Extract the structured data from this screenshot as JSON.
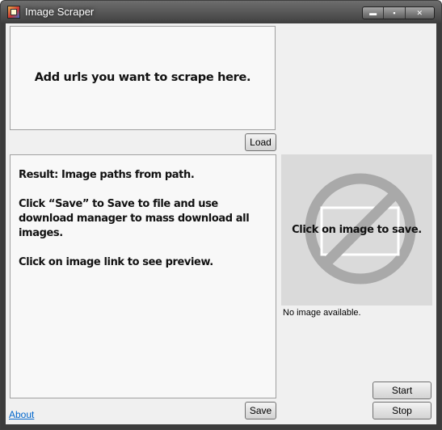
{
  "window": {
    "title": "Image Scraper",
    "controls": {
      "minimize": "▬",
      "maximize": "▪",
      "close": "✕"
    }
  },
  "url_input": {
    "hint": "Add urls you want to scrape here."
  },
  "buttons": {
    "load": "Load",
    "save": "Save",
    "start": "Start",
    "stop": "Stop"
  },
  "results": {
    "line1": "Result: Image paths from path.",
    "line2": "Click “Save” to Save to file and use download manager to mass download all images.",
    "line3": "Click on image link to see preview."
  },
  "preview": {
    "caption": "Click on image to save.",
    "status": "No image available.",
    "icon": "no-image-icon"
  },
  "footer": {
    "about": "About"
  },
  "colors": {
    "link": "#0066cc",
    "preview_bg": "#dadada"
  }
}
